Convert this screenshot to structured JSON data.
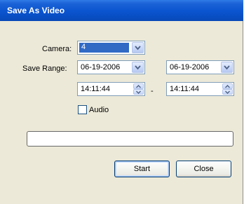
{
  "window": {
    "title": "Save As Video"
  },
  "labels": {
    "camera": "Camera:",
    "save_range": "Save Range:"
  },
  "camera": {
    "selected": "4"
  },
  "range": {
    "start_date": "06-19-2006",
    "start_time": "14:11:44",
    "end_date": "06-19-2006",
    "end_time": "14:11:44",
    "separator": "-"
  },
  "audio": {
    "label": "Audio",
    "checked": false
  },
  "buttons": {
    "start": "Start",
    "close": "Close"
  },
  "progress": {
    "value": 0
  },
  "colors": {
    "titlebar": "#0a54cf",
    "selection": "#316ac5",
    "dialog_bg": "#ece9d8"
  },
  "icons": {
    "dropdown": "chevron-down-icon",
    "spin_up": "spin-up-icon",
    "spin_down": "spin-down-icon",
    "checkbox": "checkbox-icon"
  }
}
